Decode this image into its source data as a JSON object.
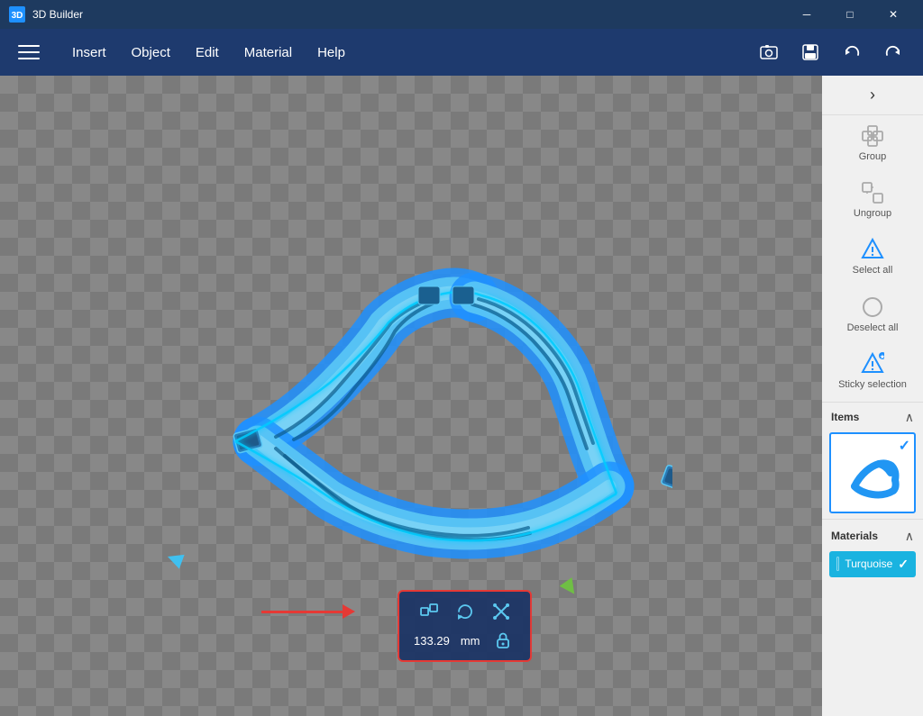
{
  "titleBar": {
    "title": "3D Builder",
    "minBtn": "─",
    "maxBtn": "□",
    "closeBtn": "✕"
  },
  "menuBar": {
    "items": [
      "Insert",
      "Object",
      "Edit",
      "Material",
      "Help"
    ],
    "icons": {
      "screenshot": "📷",
      "save": "💾",
      "undo": "↩",
      "redo": "↪"
    }
  },
  "sidebar": {
    "collapseLabel": "›",
    "items": [
      {
        "id": "group",
        "label": "Group",
        "icon": "⊞"
      },
      {
        "id": "ungroup",
        "label": "Ungroup",
        "icon": "⊟"
      },
      {
        "id": "select-all",
        "label": "Select all",
        "icon": "△"
      },
      {
        "id": "deselect-all",
        "label": "Deselect all",
        "icon": "○"
      },
      {
        "id": "sticky-selection",
        "label": "Sticky selection",
        "icon": "△"
      }
    ],
    "itemsSection": {
      "label": "Items",
      "collapseIcon": "∧"
    },
    "materialsSection": {
      "label": "Materials",
      "collapseIcon": "∧"
    },
    "materialItem": {
      "name": "Turquoise",
      "color": "#1ab3e0"
    }
  },
  "toolbar": {
    "icons": {
      "resize": "⇔",
      "rotate": "↺",
      "transform": "✕"
    },
    "value": "133.29",
    "unit": "mm",
    "lockIcon": "🔒"
  },
  "viewport": {
    "bgColor": "#888888"
  }
}
